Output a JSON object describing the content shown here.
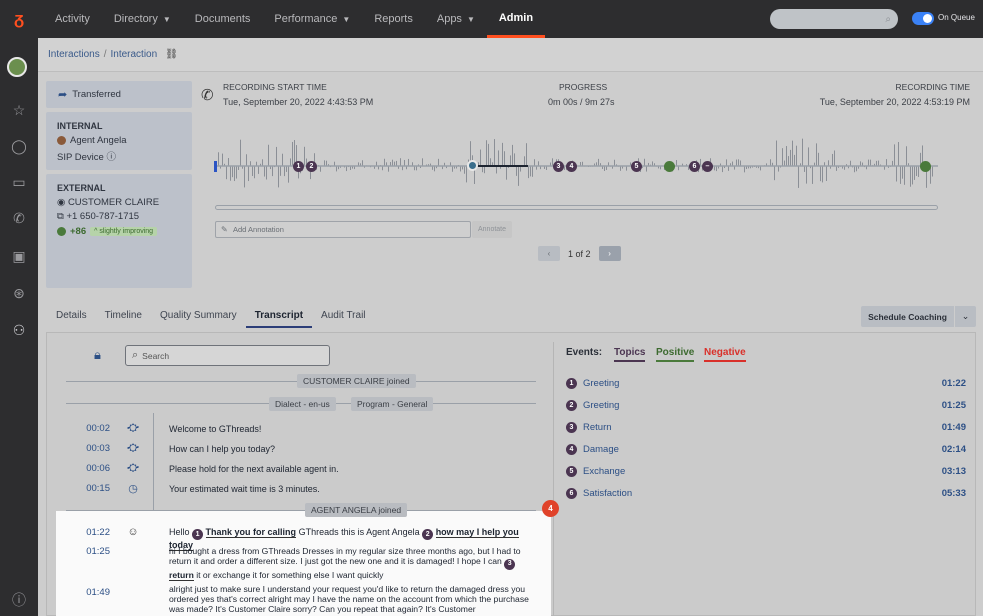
{
  "nav": {
    "items": [
      "Activity",
      "Directory",
      "Documents",
      "Performance",
      "Reports",
      "Apps",
      "Admin"
    ],
    "search_icon": "search-icon",
    "status": "On Queue",
    "accent": "#ff4f1f"
  },
  "breadcrumb": {
    "root": "Interactions",
    "sep": "/",
    "current": "Interaction"
  },
  "participants": {
    "transferred": "Transferred",
    "internal_heading": "INTERNAL",
    "agent": "Agent Angela",
    "device": "SIP Device",
    "external_heading": "EXTERNAL",
    "customer": "CUSTOMER CLAIRE",
    "phone": "+1 650-787-1715",
    "score": "+86",
    "sentiment": "slightly improving"
  },
  "recording": {
    "start_label": "RECORDING START TIME",
    "start_value": "Tue, September 20, 2022 4:43:53 PM",
    "progress_label": "PROGRESS",
    "progress_value": "0m 00s / 9m 27s",
    "time_label": "RECORDING TIME",
    "time_value": "Tue, September 20, 2022 4:53:19 PM",
    "markers": [
      "1",
      "2",
      "3",
      "4",
      "5",
      "6"
    ]
  },
  "annotation": {
    "placeholder": "Add Annotation",
    "button": "Annotate"
  },
  "pager": {
    "text": "1 of 2"
  },
  "tabs": [
    "Details",
    "Timeline",
    "Quality Summary",
    "Transcript",
    "Audit Trail"
  ],
  "coaching": {
    "label": "Schedule Coaching"
  },
  "transcript": {
    "search_placeholder": "Search",
    "joined_customer": "CUSTOMER CLAIRE joined",
    "dialect": "Dialect - en-us",
    "program": "Program - General",
    "joined_agent": "AGENT ANGELA joined",
    "flag_count": "4",
    "lines": [
      {
        "time": "00:02",
        "text": "Welcome to GThreads!"
      },
      {
        "time": "00:03",
        "text": "How can I help you today?"
      },
      {
        "time": "00:06",
        "text": "Please hold for the next available agent in."
      },
      {
        "time": "00:15",
        "text": "Your estimated wait time is 3 minutes."
      }
    ],
    "agent_line": {
      "time": "01:22",
      "pre": "Hello",
      "m1": "1",
      "p1": "Thank you for calling",
      "mid": "GThreads this is Agent Angela",
      "m2": "2",
      "p2": "how may I help you today"
    },
    "customer_line": {
      "time": "01:25",
      "text": "hi I bought a dress from GThreads Dresses in my regular size three months ago, but I had to return it and order a different size. I just got the new one and it is damaged! I hope I can",
      "m3": "3",
      "p3": "return",
      "tail": "it or exchange it for something else I want quickly"
    },
    "line4": {
      "time": "01:49",
      "text": "alright just to make sure I understand your request you'd like to return the damaged dress you ordered yes that's correct alright may I have the name on the account from which the purchase was made? It's Customer Claire sorry? Can you repeat that again? It's Customer"
    }
  },
  "events": {
    "label": "Events:",
    "filters": [
      {
        "label": "Topics",
        "color": "#4b3551"
      },
      {
        "label": "Positive",
        "color": "#4a7a3b"
      },
      {
        "label": "Negative",
        "color": "#d9302a"
      }
    ],
    "items": [
      {
        "num": "1",
        "name": "Greeting",
        "time": "01:22"
      },
      {
        "num": "2",
        "name": "Greeting",
        "time": "01:25"
      },
      {
        "num": "3",
        "name": "Return",
        "time": "01:49"
      },
      {
        "num": "4",
        "name": "Damage",
        "time": "02:14"
      },
      {
        "num": "5",
        "name": "Exchange",
        "time": "03:13"
      },
      {
        "num": "6",
        "name": "Satisfaction",
        "time": "05:33"
      }
    ]
  }
}
